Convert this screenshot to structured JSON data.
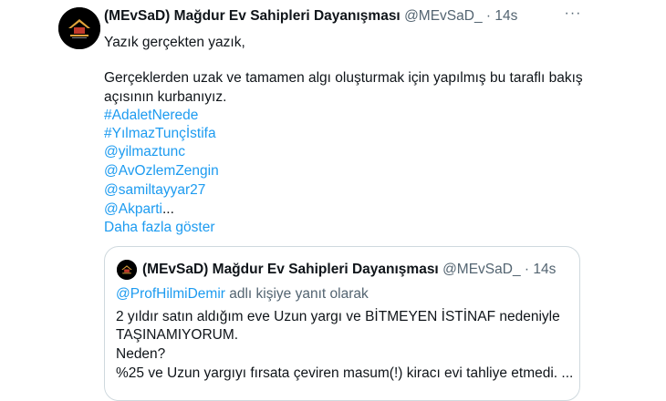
{
  "tweet": {
    "author_name": "(MEvSaD) Mağdur Ev Sahipleri Dayanışması",
    "handle": "@MEvSaD_",
    "separator": "·",
    "time": "14s",
    "more_label": "···",
    "lines": [
      "Yazık gerçekten yazık,",
      "Gerçeklerden uzak ve tamamen algı oluşturmak için yapılmış bu taraflı bakış",
      "açısının kurbanıyız."
    ],
    "hashtags": [
      "#AdaletNerede",
      "#YılmazTunçİstifa"
    ],
    "mentions": [
      "@yilmaztunc",
      "@AvOzlemZengin",
      "@samiltayyar27",
      "@Akparti"
    ],
    "ellipsis": "...",
    "show_more": "Daha fazla göster"
  },
  "quoted": {
    "author_name": "(MEvSaD) Mağdur Ev Sahipleri Dayanışması",
    "handle": "@MEvSaD_",
    "separator": "·",
    "time": "14s",
    "reply_to_handle": "@ProfHilmiDemir",
    "reply_to_suffix": " adlı kişiye yanıt olarak",
    "lines": [
      "2 yıldır satın aldığım eve Uzun yargı ve BİTMEYEN İSTİNAF nedeniyle",
      "TAŞINAMIYORUM.",
      "Neden?",
      "%25 ve Uzun yargıyı fırsata çeviren masum(!) kiracı evi tahliye etmedi. ..."
    ]
  },
  "colors": {
    "link": "#1d9bf0",
    "muted": "#536471",
    "border": "#cfd9de"
  },
  "icons": {
    "avatar": "house-logo-avatar",
    "more": "more-options-icon"
  }
}
